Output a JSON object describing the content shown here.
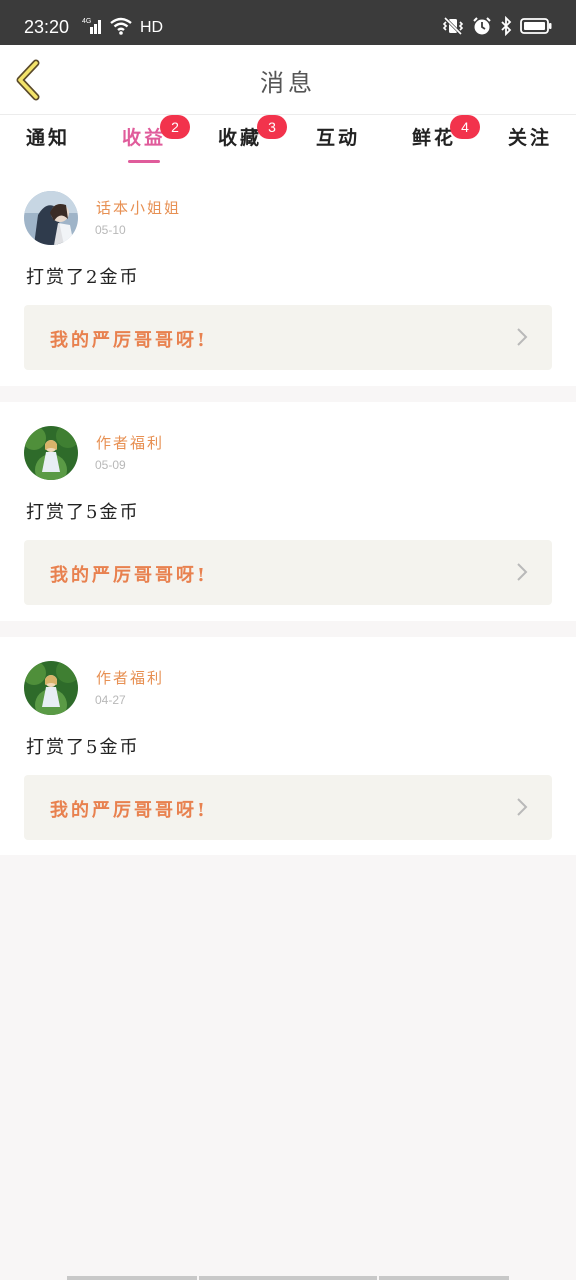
{
  "status_bar": {
    "time": "23:20",
    "network": "4G",
    "quality": "HD",
    "icons": [
      "signal-icon",
      "wifi-icon",
      "vibrate-icon",
      "alarm-icon",
      "bluetooth-icon",
      "battery-icon"
    ]
  },
  "header": {
    "title": "消息",
    "back_icon": "back-chevron-icon"
  },
  "tabs": [
    {
      "label": "通知",
      "badge": ""
    },
    {
      "label": "收益",
      "badge": "2",
      "active": true
    },
    {
      "label": "收藏",
      "badge": "3"
    },
    {
      "label": "互动",
      "badge": ""
    },
    {
      "label": "鲜花",
      "badge": "4"
    },
    {
      "label": "关注",
      "badge": ""
    }
  ],
  "messages": [
    {
      "sender": "话本小姐姐",
      "date": "05-10",
      "text": "打赏了2金币",
      "reply": "我的严厉哥哥呀!"
    },
    {
      "sender": "作者福利",
      "date": "05-09",
      "text": "打赏了5金币",
      "reply": "我的严厉哥哥呀!"
    },
    {
      "sender": "作者福利",
      "date": "04-27",
      "text": "打赏了5金币",
      "reply": "我的严厉哥哥呀!"
    }
  ],
  "colors": {
    "accent": "#e05c9b",
    "badge": "#f2334c",
    "sender": "#e79053",
    "reply_text": "#e8814f",
    "reply_bg": "#f4f3ee",
    "status_bar": "#3b3b3b"
  }
}
